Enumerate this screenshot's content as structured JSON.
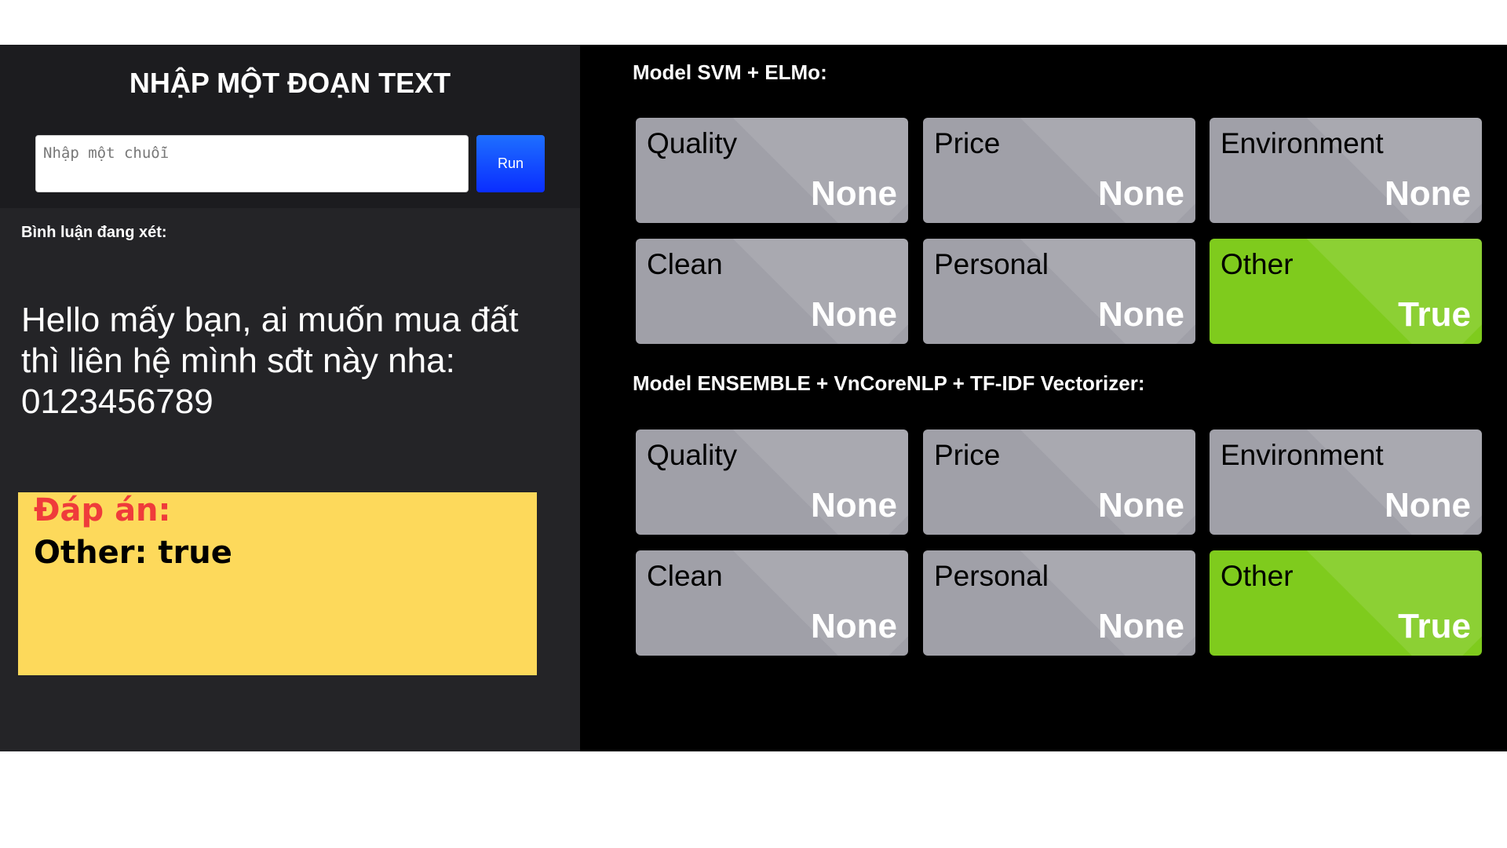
{
  "left_panel": {
    "title": "NHẬP MỘT ĐOẠN TEXT",
    "input_placeholder": "Nhập một chuỗi",
    "input_value": "",
    "run_label": "Run",
    "comment_label": "Bình luận đang xét:",
    "comment_text": "Hello mấy bạn, ai muốn mua đất thì liên hệ mình sđt này nha: 0123456789",
    "answer_title": "Đáp án:",
    "answer_value": "Other: true"
  },
  "models": [
    {
      "title": "Model SVM + ELMo:",
      "results": [
        {
          "category": "Quality",
          "value": "None"
        },
        {
          "category": "Price",
          "value": "None"
        },
        {
          "category": "Environment",
          "value": "None"
        },
        {
          "category": "Clean",
          "value": "None"
        },
        {
          "category": "Personal",
          "value": "None"
        },
        {
          "category": "Other",
          "value": "True"
        }
      ]
    },
    {
      "title": "Model ENSEMBLE + VnCoreNLP + TF-IDF Vectorizer:",
      "results": [
        {
          "category": "Quality",
          "value": "None"
        },
        {
          "category": "Price",
          "value": "None"
        },
        {
          "category": "Environment",
          "value": "None"
        },
        {
          "category": "Clean",
          "value": "None"
        },
        {
          "category": "Personal",
          "value": "None"
        },
        {
          "category": "Other",
          "value": "True"
        }
      ]
    }
  ],
  "colors": {
    "true_card": "#7fcb1d",
    "none_card": "#a0a0a8",
    "answer_box": "#fdd95b",
    "answer_title": "#ef3b3b",
    "run_button": "#0a2dff"
  }
}
